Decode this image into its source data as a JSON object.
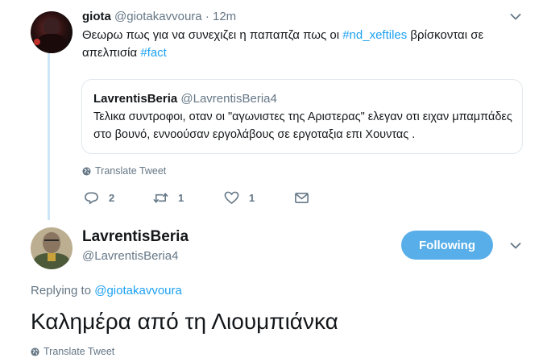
{
  "tweet": {
    "author_name": "giota",
    "author_handle": "@giotakavvoura",
    "separator": "·",
    "time": "12m",
    "text_before": "Θεωρω πως για να συνεχιζει η παπαπζα πως οι ",
    "hashtag1": "#nd_xeftiles",
    "text_middle": " βρίσκονται σε απελπισία ",
    "hashtag2": "#fact",
    "translate_label": "Translate Tweet",
    "actions": {
      "reply_count": "2",
      "retweet_count": "1",
      "like_count": "1"
    }
  },
  "quote": {
    "author_name": "LavrentisBeria",
    "author_handle": "@LavrentisBeria4",
    "text": "Τελικα συντροφοι, οταν οι \"αγωνιστες της Αριστερας\" ελεγαν οτι ειχαν μπαμπάδες στο βουνό, εννοούσαν εργολάβους σε εργοταξια επι Χουντας ."
  },
  "reply": {
    "author_name": "LavrentisBeria",
    "author_handle": "@LavrentisBeria4",
    "follow_label": "Following",
    "replying_prefix": "Replying to ",
    "replying_handle": "@giotakavvoura",
    "text": "Καλημέρα από τη Λιουμπιάνκα",
    "translate_label": "Translate Tweet"
  },
  "icons": {
    "caret": "chevron-down-icon",
    "reply": "reply-icon",
    "retweet": "retweet-icon",
    "like": "heart-icon",
    "message": "envelope-icon",
    "globe": "globe-icon"
  },
  "colors": {
    "accent": "#1da1f2",
    "follow_button": "#58aee8",
    "muted": "#657786",
    "thread_line": "#cce6f8"
  }
}
